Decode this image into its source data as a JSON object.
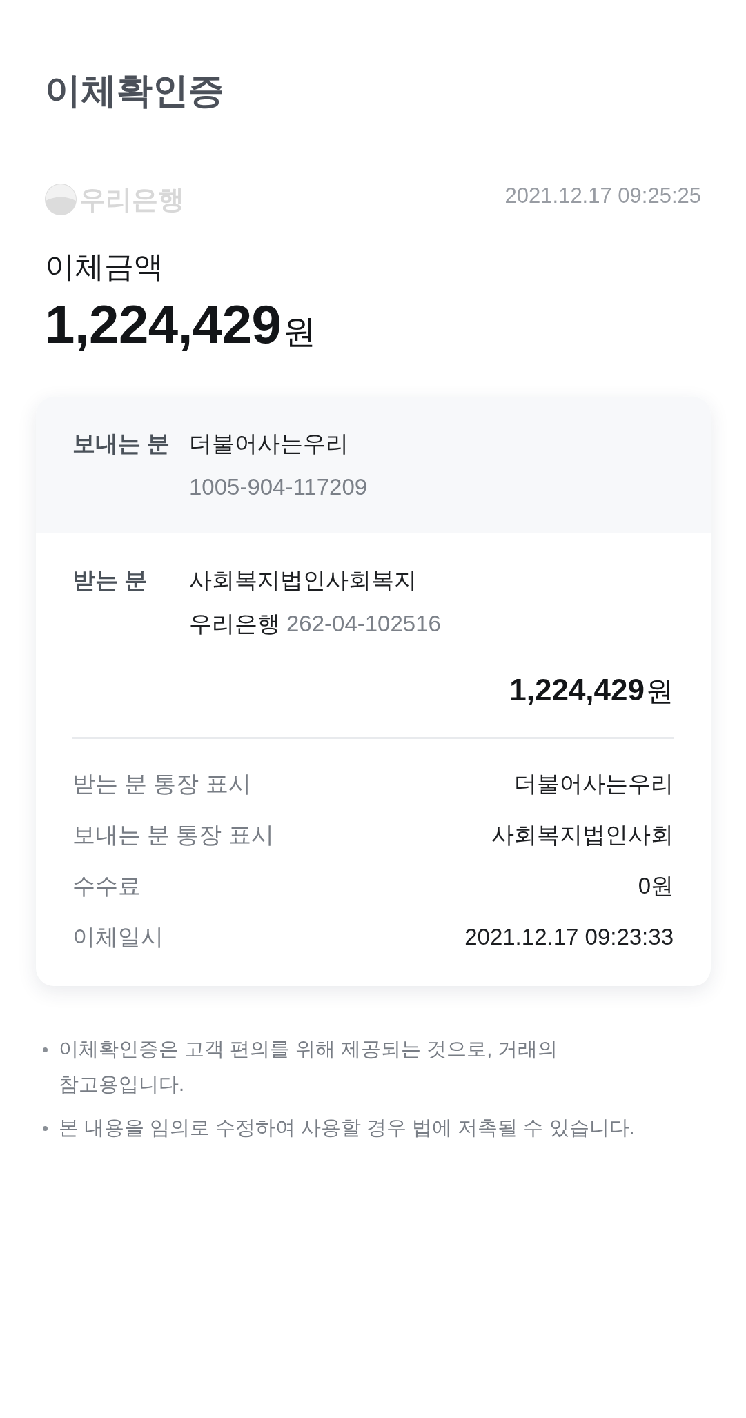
{
  "title": "이체확인증",
  "bank_logo": {
    "text": "우리은행"
  },
  "issued_at": "2021.12.17 09:25:25",
  "amount": {
    "label": "이체금액",
    "value": "1,224,429",
    "unit": "원"
  },
  "sender": {
    "label": "보내는 분",
    "name": "더불어사는우리",
    "account": "1005-904-117209"
  },
  "recipient": {
    "label": "받는 분",
    "name": "사회복지법인사회복지",
    "bank": "우리은행",
    "account": "262-04-102516",
    "amount": "1,224,429",
    "unit": "원"
  },
  "details": [
    {
      "label": "받는 분 통장 표시",
      "value": "더불어사는우리"
    },
    {
      "label": "보내는 분 통장 표시",
      "value": "사회복지법인사회"
    },
    {
      "label": "수수료",
      "value": "0원"
    },
    {
      "label": "이체일시",
      "value": "2021.12.17 09:23:33"
    }
  ],
  "notes": [
    "이체확인증은 고객 편의를 위해 제공되는 것으로, 거래의 참고용입니다.",
    "본 내용을 임의로 수정하여 사용할 경우 법에 저촉될 수 있습니다."
  ]
}
